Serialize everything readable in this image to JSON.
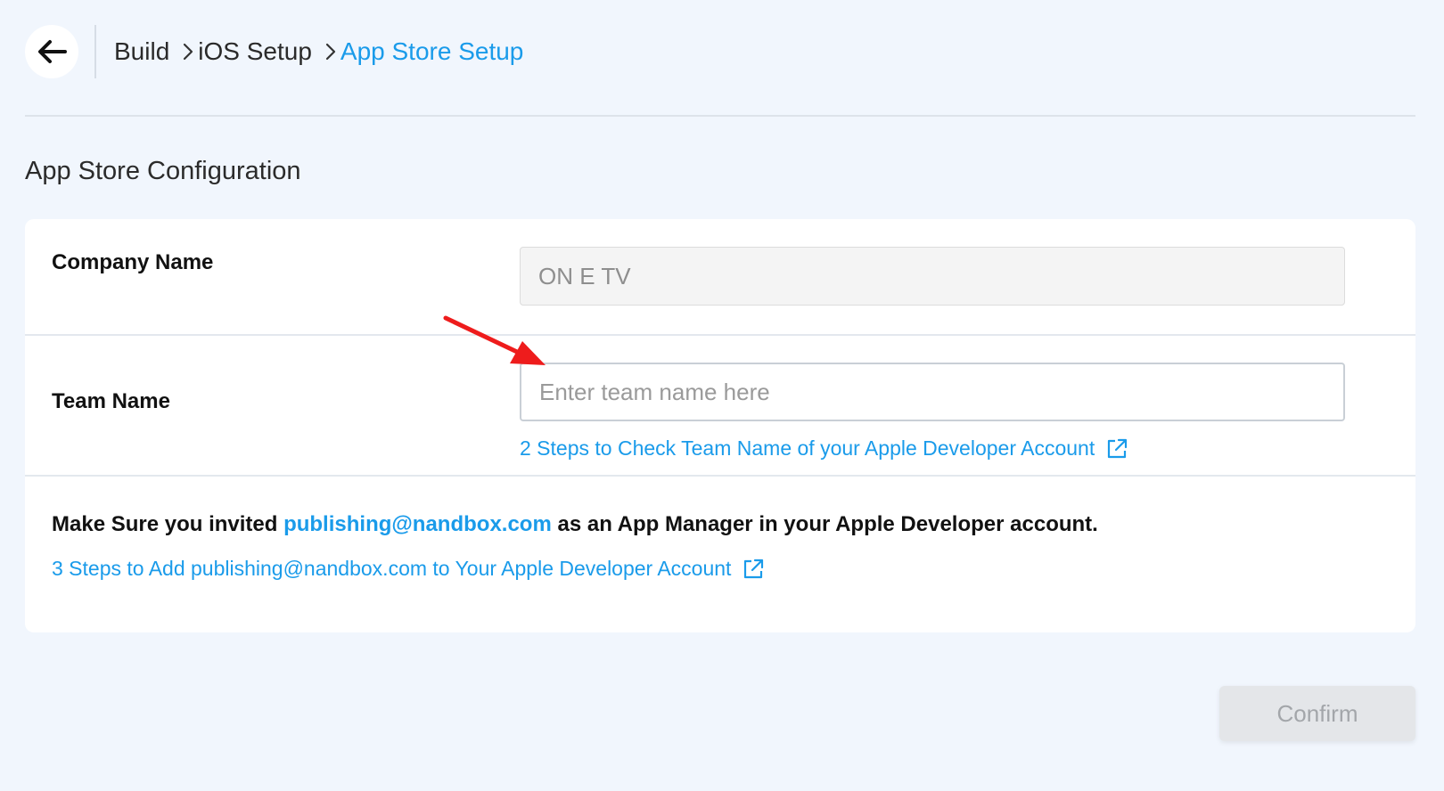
{
  "header": {
    "back_icon": "arrow-left-icon",
    "breadcrumb": [
      {
        "label": "Build",
        "active": false
      },
      {
        "label": "iOS Setup",
        "active": false
      },
      {
        "label": "App Store Setup",
        "active": true
      }
    ]
  },
  "section": {
    "title": "App Store Configuration"
  },
  "form": {
    "company": {
      "label": "Company Name",
      "value": "ON E TV"
    },
    "team": {
      "label": "Team Name",
      "value": "",
      "placeholder": "Enter team name here",
      "help_link": "2 Steps to Check Team Name of your Apple Developer Account"
    },
    "note": {
      "prefix": "Make Sure you invited ",
      "email": "publishing@nandbox.com",
      "suffix": " as an App Manager in your Apple Developer account.",
      "help_link": "3 Steps to Add publishing@nandbox.com to Your Apple Developer Account"
    }
  },
  "actions": {
    "confirm_label": "Confirm",
    "confirm_enabled": false
  },
  "colors": {
    "accent": "#1a9bea",
    "background": "#f1f6fd",
    "annotation_arrow": "#ee1c1c"
  }
}
